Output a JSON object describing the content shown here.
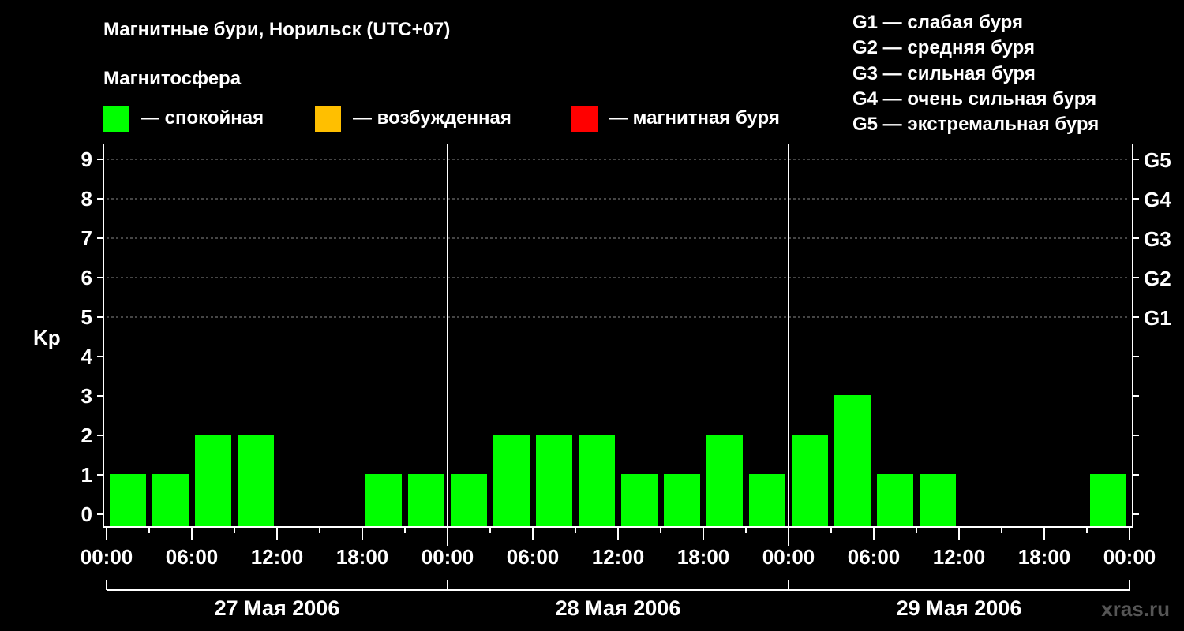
{
  "title": "Магнитные бури, Норильск (UTC+07)",
  "legend": {
    "heading": "Магнитосфера",
    "items": [
      {
        "color": "#00ff00",
        "label": "— спокойная"
      },
      {
        "color": "#ffbf00",
        "label": "— возбужденная"
      },
      {
        "color": "#ff0000",
        "label": "— магнитная буря"
      }
    ]
  },
  "g_legend": [
    "G1 — слабая буря",
    "G2 — средняя буря",
    "G3 — сильная буря",
    "G4 — очень сильная буря",
    "G5 — экстремальная буря"
  ],
  "watermark": "xras.ru",
  "chart_data": {
    "type": "bar",
    "ylabel": "Kp",
    "ylim": [
      0,
      9
    ],
    "yticks": [
      0,
      1,
      2,
      3,
      4,
      5,
      6,
      7,
      8,
      9
    ],
    "right_ticks": [
      {
        "kp": 5,
        "label": "G1"
      },
      {
        "kp": 6,
        "label": "G2"
      },
      {
        "kp": 7,
        "label": "G3"
      },
      {
        "kp": 8,
        "label": "G4"
      },
      {
        "kp": 9,
        "label": "G5"
      }
    ],
    "grid": "dashed horizontal at Kp 5–9",
    "x_tick_labels": [
      "00:00",
      "06:00",
      "12:00",
      "18:00",
      "00:00",
      "06:00",
      "12:00",
      "18:00",
      "00:00",
      "06:00",
      "12:00",
      "18:00",
      "00:00"
    ],
    "days": [
      "27 Мая 2006",
      "28 Мая 2006",
      "29 Мая 2006"
    ],
    "interval_hours": 3,
    "values": [
      1,
      1,
      2,
      2,
      0,
      0,
      1,
      1,
      1,
      2,
      2,
      2,
      1,
      1,
      2,
      1,
      2,
      3,
      1,
      1,
      0,
      0,
      0,
      1
    ],
    "bar_color": "#00ff00"
  }
}
